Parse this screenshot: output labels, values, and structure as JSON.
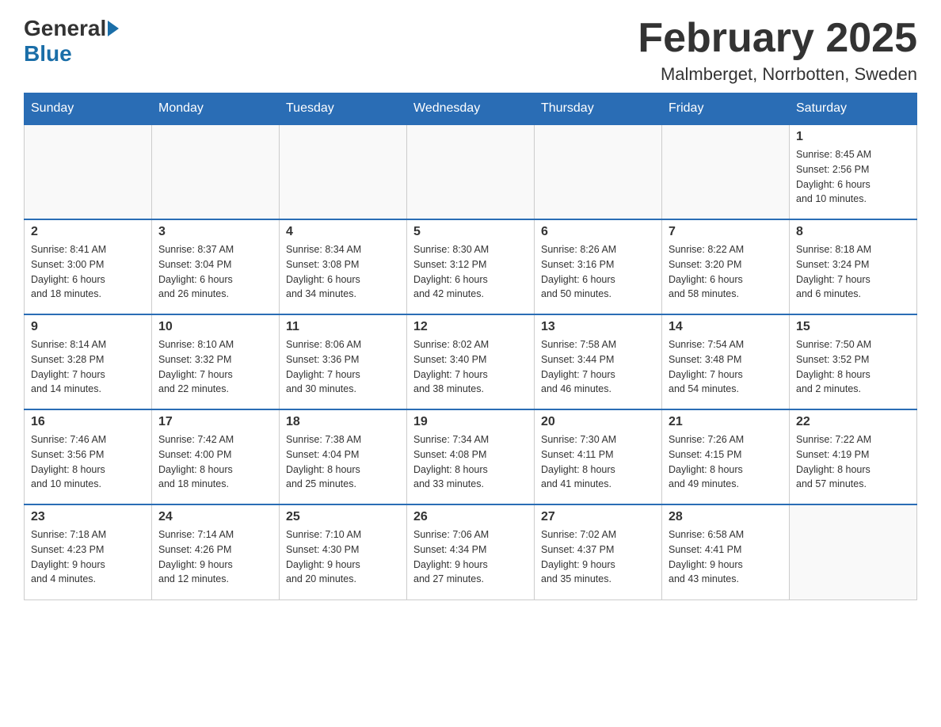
{
  "logo": {
    "general": "General",
    "blue": "Blue"
  },
  "header": {
    "title": "February 2025",
    "location": "Malmberget, Norrbotten, Sweden"
  },
  "weekdays": [
    "Sunday",
    "Monday",
    "Tuesday",
    "Wednesday",
    "Thursday",
    "Friday",
    "Saturday"
  ],
  "weeks": [
    [
      {
        "day": "",
        "info": ""
      },
      {
        "day": "",
        "info": ""
      },
      {
        "day": "",
        "info": ""
      },
      {
        "day": "",
        "info": ""
      },
      {
        "day": "",
        "info": ""
      },
      {
        "day": "",
        "info": ""
      },
      {
        "day": "1",
        "info": "Sunrise: 8:45 AM\nSunset: 2:56 PM\nDaylight: 6 hours\nand 10 minutes."
      }
    ],
    [
      {
        "day": "2",
        "info": "Sunrise: 8:41 AM\nSunset: 3:00 PM\nDaylight: 6 hours\nand 18 minutes."
      },
      {
        "day": "3",
        "info": "Sunrise: 8:37 AM\nSunset: 3:04 PM\nDaylight: 6 hours\nand 26 minutes."
      },
      {
        "day": "4",
        "info": "Sunrise: 8:34 AM\nSunset: 3:08 PM\nDaylight: 6 hours\nand 34 minutes."
      },
      {
        "day": "5",
        "info": "Sunrise: 8:30 AM\nSunset: 3:12 PM\nDaylight: 6 hours\nand 42 minutes."
      },
      {
        "day": "6",
        "info": "Sunrise: 8:26 AM\nSunset: 3:16 PM\nDaylight: 6 hours\nand 50 minutes."
      },
      {
        "day": "7",
        "info": "Sunrise: 8:22 AM\nSunset: 3:20 PM\nDaylight: 6 hours\nand 58 minutes."
      },
      {
        "day": "8",
        "info": "Sunrise: 8:18 AM\nSunset: 3:24 PM\nDaylight: 7 hours\nand 6 minutes."
      }
    ],
    [
      {
        "day": "9",
        "info": "Sunrise: 8:14 AM\nSunset: 3:28 PM\nDaylight: 7 hours\nand 14 minutes."
      },
      {
        "day": "10",
        "info": "Sunrise: 8:10 AM\nSunset: 3:32 PM\nDaylight: 7 hours\nand 22 minutes."
      },
      {
        "day": "11",
        "info": "Sunrise: 8:06 AM\nSunset: 3:36 PM\nDaylight: 7 hours\nand 30 minutes."
      },
      {
        "day": "12",
        "info": "Sunrise: 8:02 AM\nSunset: 3:40 PM\nDaylight: 7 hours\nand 38 minutes."
      },
      {
        "day": "13",
        "info": "Sunrise: 7:58 AM\nSunset: 3:44 PM\nDaylight: 7 hours\nand 46 minutes."
      },
      {
        "day": "14",
        "info": "Sunrise: 7:54 AM\nSunset: 3:48 PM\nDaylight: 7 hours\nand 54 minutes."
      },
      {
        "day": "15",
        "info": "Sunrise: 7:50 AM\nSunset: 3:52 PM\nDaylight: 8 hours\nand 2 minutes."
      }
    ],
    [
      {
        "day": "16",
        "info": "Sunrise: 7:46 AM\nSunset: 3:56 PM\nDaylight: 8 hours\nand 10 minutes."
      },
      {
        "day": "17",
        "info": "Sunrise: 7:42 AM\nSunset: 4:00 PM\nDaylight: 8 hours\nand 18 minutes."
      },
      {
        "day": "18",
        "info": "Sunrise: 7:38 AM\nSunset: 4:04 PM\nDaylight: 8 hours\nand 25 minutes."
      },
      {
        "day": "19",
        "info": "Sunrise: 7:34 AM\nSunset: 4:08 PM\nDaylight: 8 hours\nand 33 minutes."
      },
      {
        "day": "20",
        "info": "Sunrise: 7:30 AM\nSunset: 4:11 PM\nDaylight: 8 hours\nand 41 minutes."
      },
      {
        "day": "21",
        "info": "Sunrise: 7:26 AM\nSunset: 4:15 PM\nDaylight: 8 hours\nand 49 minutes."
      },
      {
        "day": "22",
        "info": "Sunrise: 7:22 AM\nSunset: 4:19 PM\nDaylight: 8 hours\nand 57 minutes."
      }
    ],
    [
      {
        "day": "23",
        "info": "Sunrise: 7:18 AM\nSunset: 4:23 PM\nDaylight: 9 hours\nand 4 minutes."
      },
      {
        "day": "24",
        "info": "Sunrise: 7:14 AM\nSunset: 4:26 PM\nDaylight: 9 hours\nand 12 minutes."
      },
      {
        "day": "25",
        "info": "Sunrise: 7:10 AM\nSunset: 4:30 PM\nDaylight: 9 hours\nand 20 minutes."
      },
      {
        "day": "26",
        "info": "Sunrise: 7:06 AM\nSunset: 4:34 PM\nDaylight: 9 hours\nand 27 minutes."
      },
      {
        "day": "27",
        "info": "Sunrise: 7:02 AM\nSunset: 4:37 PM\nDaylight: 9 hours\nand 35 minutes."
      },
      {
        "day": "28",
        "info": "Sunrise: 6:58 AM\nSunset: 4:41 PM\nDaylight: 9 hours\nand 43 minutes."
      },
      {
        "day": "",
        "info": ""
      }
    ]
  ]
}
